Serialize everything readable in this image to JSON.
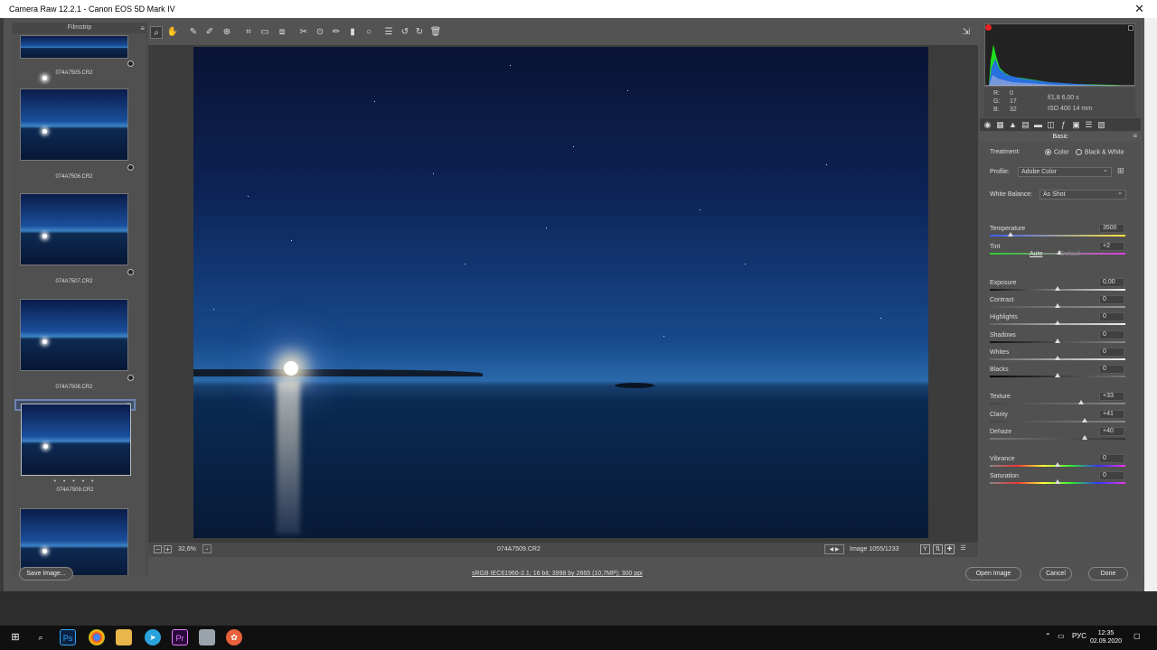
{
  "window": {
    "title": "Camera Raw 12.2.1  -  Canon EOS 5D Mark IV",
    "close_icon": "close-icon"
  },
  "filmstrip": {
    "title": "Filmstrip",
    "items": [
      {
        "name": "074A7505.CR2"
      },
      {
        "name": "074A7506.CR2"
      },
      {
        "name": "074A7507.CR2"
      },
      {
        "name": "074A7508.CR2"
      },
      {
        "name": "074A7509.CR2",
        "selected": true,
        "rating": "• • • • •"
      },
      {
        "name": ""
      }
    ]
  },
  "toolbar": {
    "tools": [
      "zoom-icon",
      "hand-icon",
      "white-balance-icon",
      "color-sampler-icon",
      "target-adjust-icon",
      "crop-icon",
      "straighten-icon",
      "transform-icon",
      "spot-removal-icon",
      "red-eye-icon",
      "adjustment-brush-icon",
      "graduated-filter-icon",
      "radial-filter-icon",
      "presets-icon",
      "rotate-ccw-icon",
      "rotate-cw-icon",
      "trash-icon"
    ],
    "fullscreen_icon": "fullscreen-icon"
  },
  "preview": {
    "zoom": "32,6%",
    "filename": "074A7509.CR2",
    "image_count": "Image 1055/1233"
  },
  "histogram": {
    "rgb": {
      "r_label": "R:",
      "r": "0",
      "g_label": "G:",
      "g": "17",
      "b_label": "B:",
      "b": "32"
    },
    "aperture_shutter": "f/1,8   6,00 s",
    "iso_focal": "ISO 400   14 mm"
  },
  "basic": {
    "section_title": "Basic",
    "treatment_label": "Treatment:",
    "treatment_color": "Color",
    "treatment_bw": "Black & White",
    "profile_label": "Profile:",
    "profile_value": "Adobe Color",
    "wb_label": "White Balance:",
    "wb_value": "As Shot",
    "auto": "Auto",
    "default": "Default",
    "sliders": [
      {
        "label": "Temperature",
        "value": "3500",
        "pos": 0.15
      },
      {
        "label": "Tint",
        "value": "+2",
        "pos": 0.51
      },
      {
        "label": "Exposure",
        "value": "0,00",
        "pos": 0.5
      },
      {
        "label": "Contrast",
        "value": "0",
        "pos": 0.5
      },
      {
        "label": "Highlights",
        "value": "0",
        "pos": 0.5
      },
      {
        "label": "Shadows",
        "value": "0",
        "pos": 0.5
      },
      {
        "label": "Whites",
        "value": "0",
        "pos": 0.5
      },
      {
        "label": "Blacks",
        "value": "0",
        "pos": 0.5
      },
      {
        "label": "Texture",
        "value": "+33",
        "pos": 0.67
      },
      {
        "label": "Clarity",
        "value": "+41",
        "pos": 0.7
      },
      {
        "label": "Dehaze",
        "value": "+40",
        "pos": 0.7
      },
      {
        "label": "Vibrance",
        "value": "0",
        "pos": 0.5
      },
      {
        "label": "Saturation",
        "value": "0",
        "pos": 0.5
      }
    ]
  },
  "footer": {
    "save": "Save Image...",
    "workflow": "sRGB IEC61966-2.1; 16 bit; 3998 by 2665 (10,7MP); 300 ppi",
    "open": "Open Image",
    "cancel": "Cancel",
    "done": "Done"
  },
  "taskbar": {
    "apps": [
      "windows-start-icon",
      "search-icon",
      "photoshop-icon",
      "chrome-icon",
      "file-explorer-icon",
      "telegram-icon",
      "premiere-icon",
      "app-icon",
      "app-icon-2"
    ],
    "ps_label": "Ps",
    "pr_label": "Pr",
    "lang": "РУС",
    "time": "12:35",
    "date": "02.09.2020"
  }
}
